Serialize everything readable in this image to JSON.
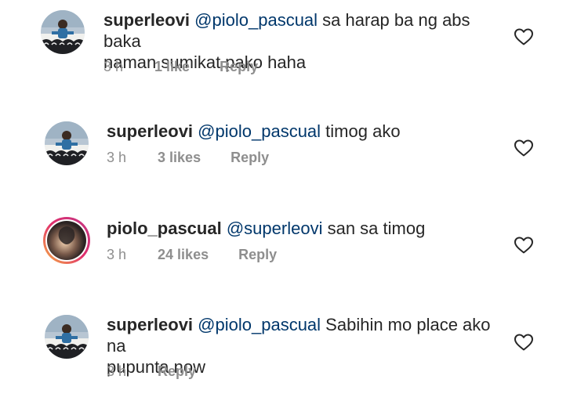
{
  "comments": [
    {
      "username": "superleovi",
      "mention": "@piolo_pascual",
      "text_line1": " sa harap ba ng abs baka",
      "text_line2": "naman sumikat pako haha",
      "time": "3 h",
      "likes": "1 like",
      "reply": "Reply",
      "avatar": "superleovi-avatar"
    },
    {
      "username": "superleovi",
      "mention": "@piolo_pascual",
      "text_line1": " timog ako",
      "time": "3 h",
      "likes": "3 likes",
      "reply": "Reply",
      "avatar": "superleovi-avatar"
    },
    {
      "username": "piolo_pascual",
      "mention": "@superleovi",
      "text_line1": " san sa timog",
      "time": "3 h",
      "likes": "24 likes",
      "reply": "Reply",
      "avatar": "piolo-pascual-avatar"
    },
    {
      "username": "superleovi",
      "mention": "@piolo_pascual",
      "text_line1": " Sabihin mo place ako na",
      "text_line2": "pupunta now",
      "time": "3 h",
      "reply": "Reply",
      "avatar": "superleovi-avatar"
    }
  ],
  "icons": {
    "like": "heart-outline-icon"
  },
  "colors": {
    "username": "#262626",
    "mention": "#00376b",
    "meta": "#8e8e8e",
    "heart": "#262626"
  }
}
